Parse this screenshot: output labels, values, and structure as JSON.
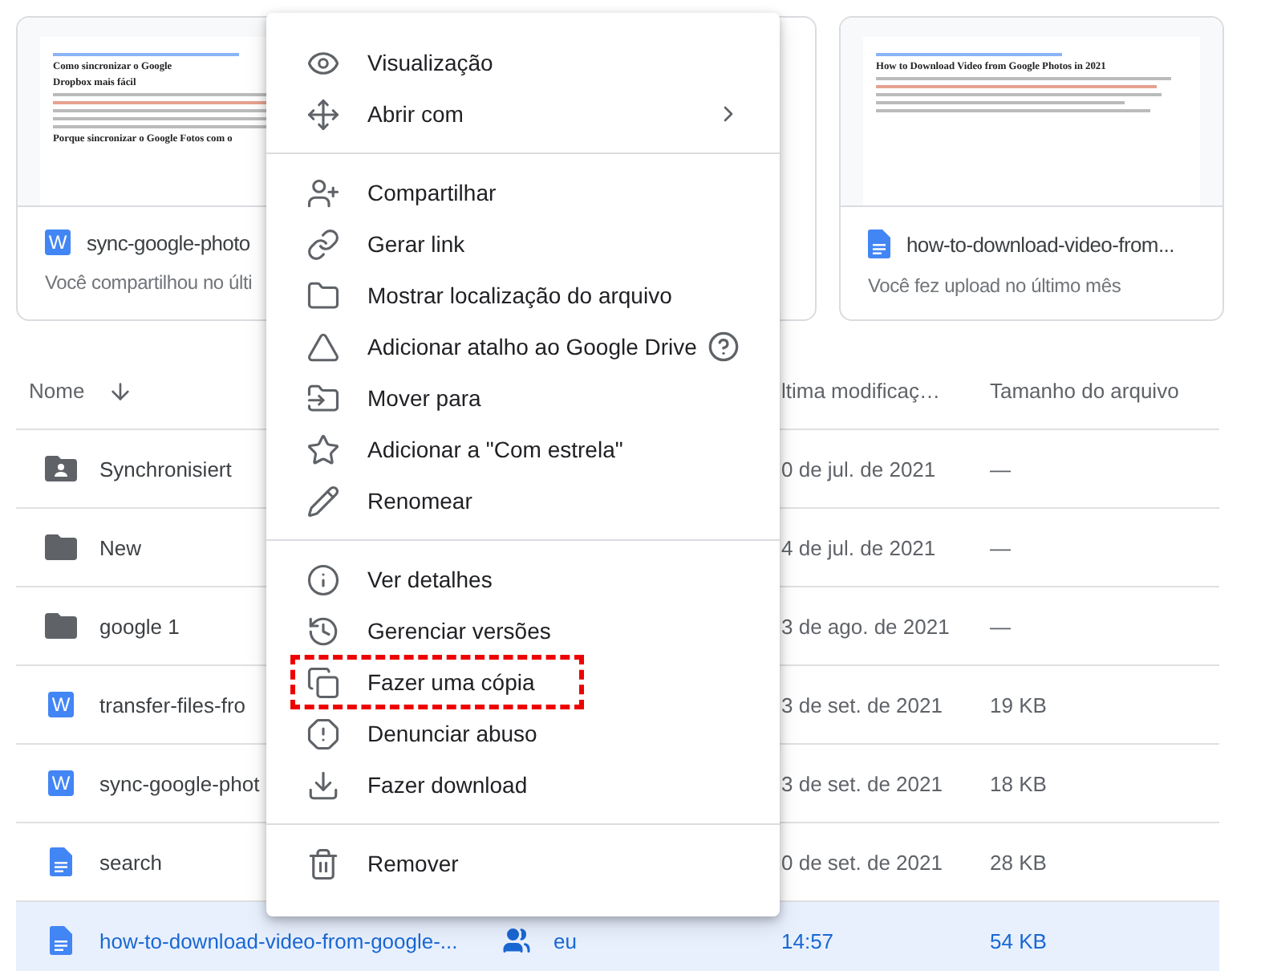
{
  "cards": [
    {
      "kind": "word",
      "icon_letter": "W",
      "name": "sync-google-photo",
      "subtitle": "Você compartilhou no últi",
      "preview": {
        "heading": "Como sincronizar o Google",
        "subheading": "Dropbox mais fácil",
        "section": "Porque sincronizar o Google Fotos com o"
      }
    },
    {
      "kind": "hidden"
    },
    {
      "kind": "doc",
      "name": "how-to-download-video-from...",
      "subtitle": "Você fez upload no último mês",
      "preview": {
        "heading": "How to Download Video from Google Photos in 2021"
      }
    }
  ],
  "table": {
    "columns": [
      {
        "label": "Nome",
        "sorted": true
      },
      {},
      {
        "label": "ltima modificaç…"
      },
      {
        "label": "Tamanho do arquivo"
      }
    ],
    "rows": [
      {
        "kind": "shared-folder",
        "name": "Synchronisiert",
        "modified": "0 de jul. de 2021",
        "size": "—",
        "selected": false
      },
      {
        "kind": "folder",
        "name": "New",
        "modified": "4 de jul. de 2021",
        "size": "—",
        "selected": false
      },
      {
        "kind": "folder",
        "name": "google 1",
        "modified": "3 de ago. de 2021",
        "size": "—",
        "selected": false
      },
      {
        "kind": "word",
        "icon_letter": "W",
        "name": "transfer-files-fro",
        "modified": "3 de set. de 2021",
        "size": "19 KB",
        "selected": false
      },
      {
        "kind": "word",
        "icon_letter": "W",
        "name": "sync-google-phot",
        "modified": "3 de set. de 2021",
        "size": "18 KB",
        "selected": false
      },
      {
        "kind": "doc",
        "name": "search",
        "modified": "0 de set. de 2021",
        "size": "28 KB",
        "selected": false
      },
      {
        "kind": "doc",
        "name": "how-to-download-video-from-google-...",
        "owner": "eu",
        "shared": true,
        "modified": "14:57",
        "size": "54 KB",
        "selected": true
      }
    ]
  },
  "context_menu": {
    "groups": [
      [
        {
          "label": "Visualização",
          "highlighted": false
        },
        {
          "label": "Abrir com",
          "submenu": true,
          "highlighted": false
        }
      ],
      [
        {
          "label": "Compartilhar",
          "highlighted": false
        },
        {
          "label": "Gerar link",
          "highlighted": false
        },
        {
          "label": "Mostrar localização do arquivo",
          "highlighted": false
        },
        {
          "label": "Adicionar atalho ao Google Drive",
          "help": true,
          "highlighted": false
        },
        {
          "label": "Mover para",
          "highlighted": false
        },
        {
          "label": "Adicionar a \"Com estrela\"",
          "highlighted": false
        },
        {
          "label": "Renomear",
          "highlighted": false
        }
      ],
      [
        {
          "label": "Ver detalhes",
          "highlighted": false
        },
        {
          "label": "Gerenciar versões",
          "highlighted": false
        },
        {
          "label": "Fazer uma cópia",
          "highlighted": true
        },
        {
          "label": "Denunciar abuso",
          "highlighted": false
        },
        {
          "label": "Fazer download",
          "highlighted": false
        }
      ],
      [
        {
          "label": "Remover",
          "highlighted": false
        }
      ]
    ]
  }
}
